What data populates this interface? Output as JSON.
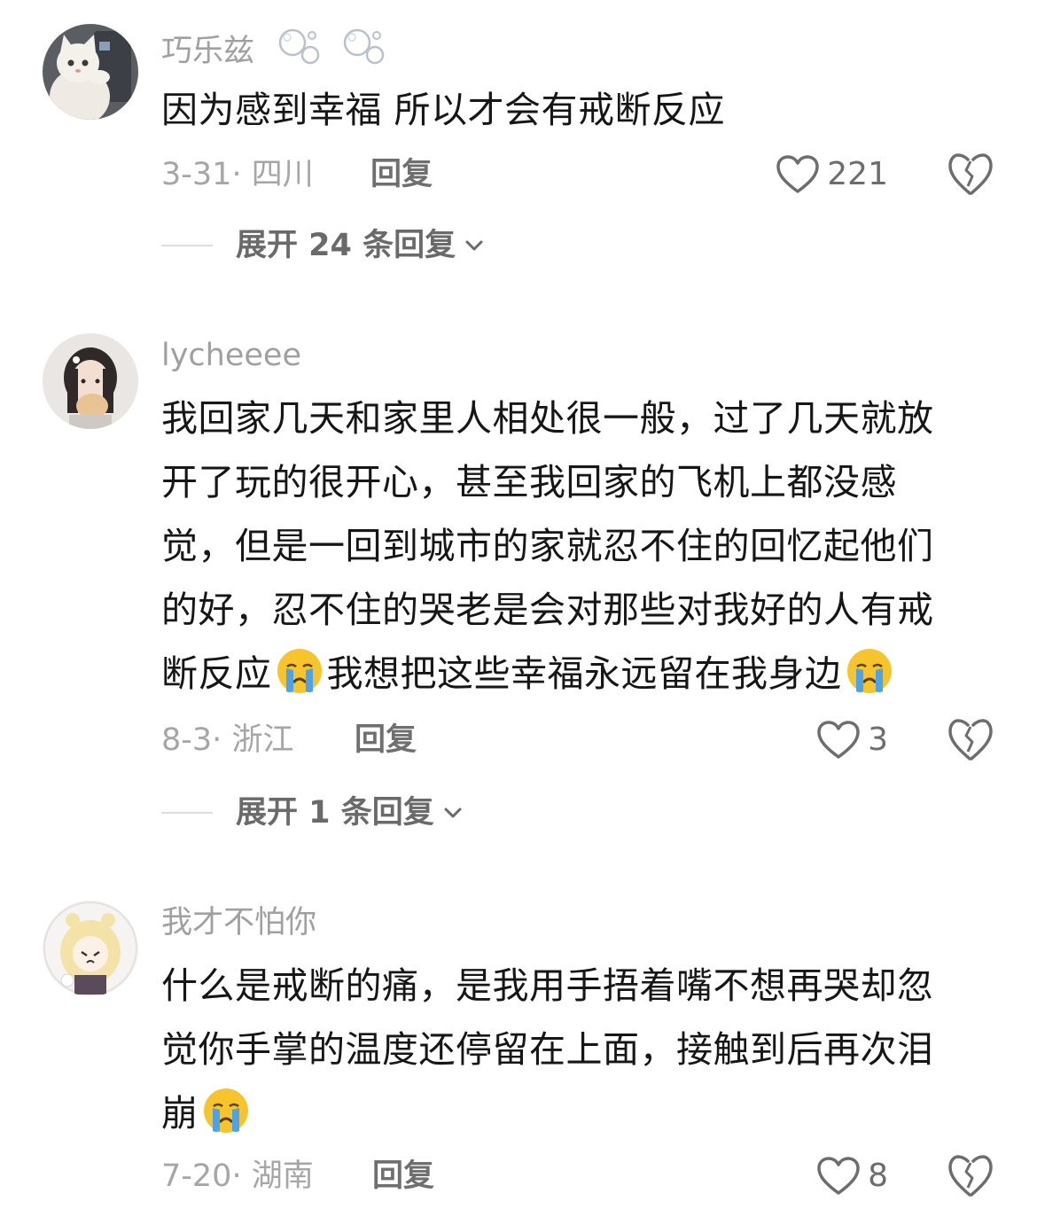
{
  "comments": [
    {
      "username": "巧乐兹",
      "text": "因为感到幸福 所以才会有戒断反应",
      "date": "3-31",
      "region": "四川",
      "reply_label": "回复",
      "likes": "221",
      "expand_label": "展开 24 条回复"
    },
    {
      "username": "lycheeee",
      "lines": [
        "我回家几天和家里人相处很一般，过了几天就放",
        "开了玩的很开心，甚至我回家的飞机上都没感",
        "觉，但是一回到城市的家就忍不住的回忆起他们",
        "的好，忍不住的哭老是会对那些对我好的人有戒"
      ],
      "line5_a": "断反应",
      "line5_b": "我想把这些幸福永远留在我身边",
      "date": "8-3",
      "region": "浙江",
      "reply_label": "回复",
      "likes": "3",
      "expand_label": "展开 1 条回复"
    },
    {
      "username": "我才不怕你",
      "lines": [
        "什么是戒断的痛，是我用手捂着嘴不想再哭却忽",
        "觉你手掌的温度还停留在上面，接触到后再次泪"
      ],
      "line3": "崩",
      "date": "7-20",
      "region": "湖南",
      "reply_label": "回复",
      "likes": "8"
    }
  ],
  "meta_separator": "· ",
  "icons": {
    "like": "heart-outline-icon",
    "dislike": "broken-heart-icon",
    "expand": "chevron-down-icon",
    "emoji": "crying-face-emoji",
    "username_decoration": "bubble-icon"
  },
  "colors": {
    "username": "#a0a0a0",
    "text": "#161616",
    "meta": "#a6a6a6",
    "reply": "#6f6f6f",
    "emoji_face": "#f7c52b",
    "emoji_tear": "#4aa3f0"
  }
}
